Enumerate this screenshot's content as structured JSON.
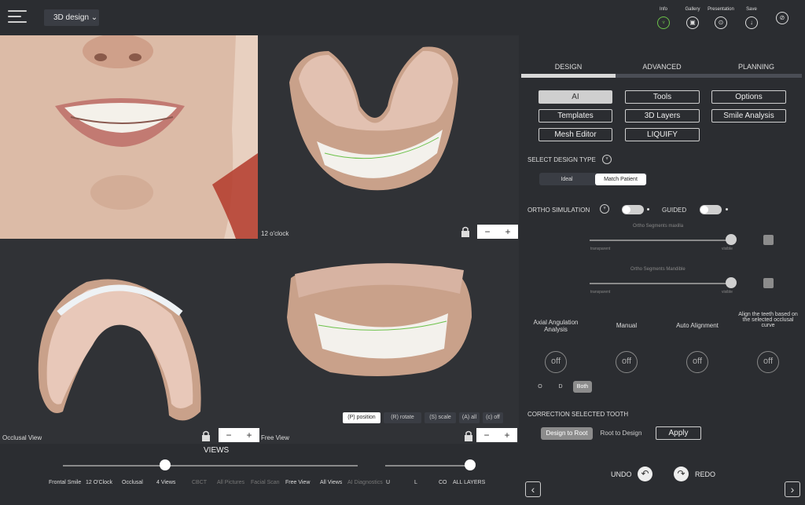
{
  "header": {
    "mode_label": "3D design",
    "tools": [
      {
        "label": "Info",
        "icon": "tooth-icon"
      },
      {
        "label": "Gallery",
        "icon": "gallery-icon"
      },
      {
        "label": "Presentation",
        "icon": "presentation-icon"
      },
      {
        "label": "Save",
        "icon": "download-icon"
      },
      {
        "label": "",
        "icon": "hide-eye-icon"
      }
    ]
  },
  "viewports": {
    "top_right_label": "12 o'clock",
    "bottom_left_label": "Occlusal View",
    "bottom_right_label": "Free View",
    "zoom_minus": "−",
    "zoom_plus": "+",
    "transform_buttons": [
      "(P) position",
      "(R) rotate",
      "(S) scale",
      "(A) all",
      "(c) off"
    ]
  },
  "views": {
    "title": "VIEWS",
    "items": [
      {
        "label": "Frontal Smile",
        "enabled": true
      },
      {
        "label": "12 O'Clock",
        "enabled": true
      },
      {
        "label": "Occlusal",
        "enabled": true
      },
      {
        "label": "4 Views",
        "enabled": true
      },
      {
        "label": "CBCT",
        "enabled": false
      },
      {
        "label": "All Pictures",
        "enabled": false
      },
      {
        "label": "Facial Scan",
        "enabled": false
      },
      {
        "label": "Free View",
        "enabled": true
      },
      {
        "label": "All Views",
        "enabled": true
      },
      {
        "label": "AI Diagnostics",
        "enabled": false
      }
    ],
    "selected_index": 3,
    "layers": [
      "U",
      "L",
      "CO",
      "ALL LAYERS"
    ],
    "selected_layer_index": 3
  },
  "panel": {
    "tabs": [
      "DESIGN",
      "ADVANCED",
      "PLANNING"
    ],
    "active_tab": 0,
    "buttons": [
      "AI",
      "Tools",
      "Options",
      "Templates",
      "3D Layers",
      "Smile Analysis",
      "Mesh Editor",
      "LIQUIFY"
    ],
    "select_design_type": "SELECT DESIGN TYPE",
    "design_types": [
      "Ideal",
      "Match Patient"
    ],
    "ortho_simulation": "ORTHO SIMULATION",
    "guided": "GUIDED",
    "slider1": {
      "title": "Ortho Segments maxilla",
      "min_label": "transparent",
      "max_label": "visible",
      "value": 1.0
    },
    "slider2": {
      "title": "Ortho Segments Mandible",
      "min_label": "transparent",
      "max_label": "visible",
      "value": 1.0
    },
    "features": [
      {
        "label": "Axial Angulation Analysis",
        "state": "off"
      },
      {
        "label": "Manual",
        "state": "off"
      },
      {
        "label": "Auto Alignment",
        "state": "off"
      },
      {
        "label": "Align the teeth based on the selected occlusal curve",
        "state": "off"
      }
    ],
    "odb": [
      "O",
      "D",
      "Both"
    ],
    "correction_title": "CORRECTION SELECTED TOOTH",
    "correction_options": [
      "Design to Root",
      "Root to Design"
    ],
    "apply": "Apply",
    "undo": "UNDO",
    "redo": "REDO",
    "prev": "‹",
    "next": "›"
  },
  "colors": {
    "accent_green": "#6cc24a",
    "background": "#2b2d31",
    "gum": "#c9a18a"
  }
}
